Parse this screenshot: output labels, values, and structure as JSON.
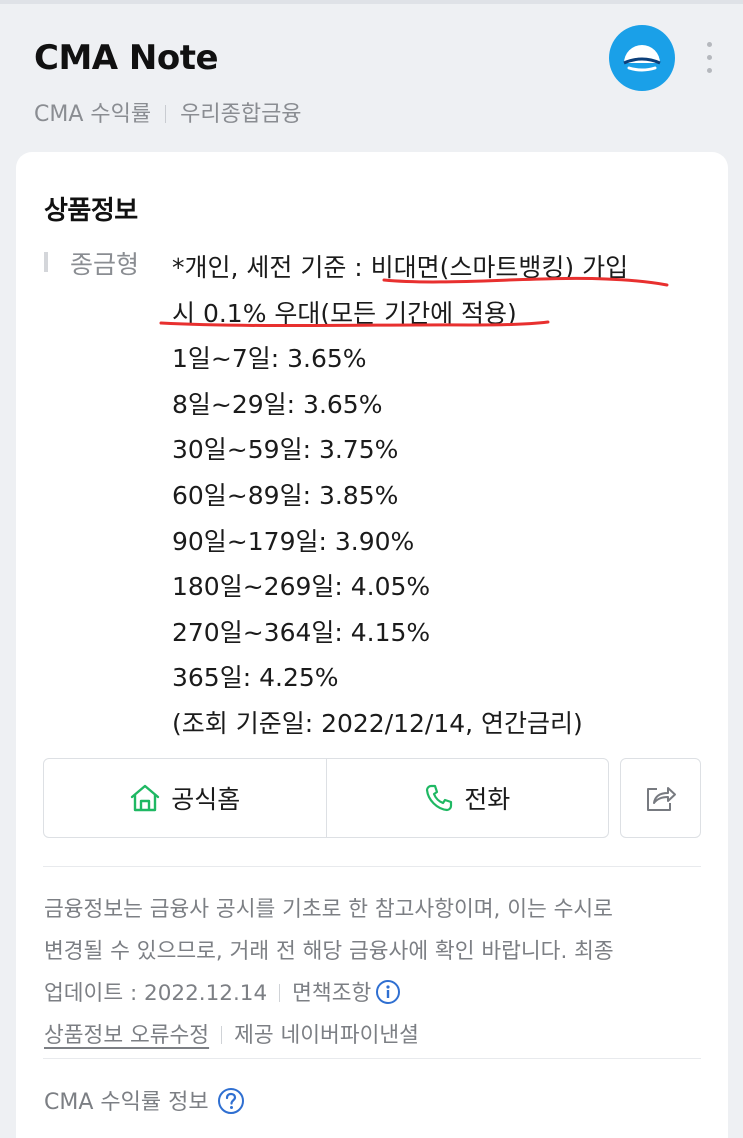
{
  "header": {
    "title": "CMA Note",
    "subtitle_left": "CMA 수익률",
    "subtitle_right": "우리종합금융",
    "logo_icon": "bank-logo-icon",
    "menu_icon": "kebab-menu-icon"
  },
  "product": {
    "section_title": "상품정보",
    "label": "종금형",
    "lines": [
      "*개인, 세전 기준 : 비대면(스마트뱅킹) 가입",
      "시 0.1% 우대(모든 기간에 적용)",
      "1일~7일: 3.65%",
      "8일~29일: 3.65%",
      "30일~59일: 3.75%",
      "60일~89일: 3.85%",
      "90일~179일: 3.90%",
      "180일~269일: 4.05%",
      "270일~364일: 4.15%",
      "365일: 4.25%",
      "(조회 기준일: 2022/12/14, 연간금리)"
    ]
  },
  "actions": {
    "home_label": "공식홈",
    "home_icon": "home-icon",
    "phone_label": "전화",
    "phone_icon": "phone-icon",
    "share_icon": "share-icon"
  },
  "notice": {
    "line1": "금융정보는 금융사 공시를 기초로 한 참고사항이며, 이는 수시로",
    "line2": "변경될 수 있으므로, 거래 전 해당 금융사에 확인 바랍니다. 최종",
    "update": "업데이트 : 2022.12.14",
    "disclaimer": "면책조항",
    "error_report": "상품정보 오류수정",
    "provider": "제공 네이버파이낸셜"
  },
  "footer": {
    "title": "CMA 수익률 정보"
  },
  "colors": {
    "accent_green": "#1fb863",
    "logo_blue": "#1aa0e8",
    "annotation_red": "#e8302f"
  }
}
